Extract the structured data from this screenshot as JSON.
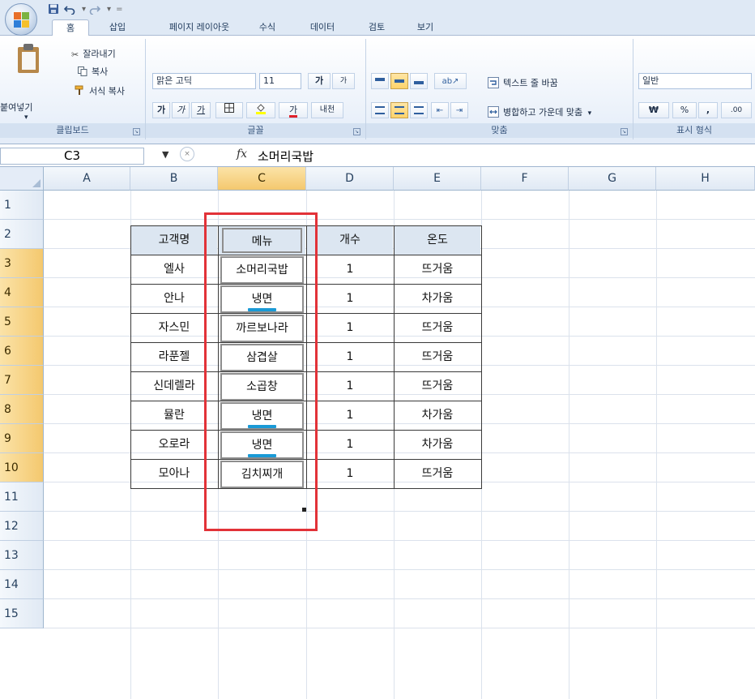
{
  "quick_access": {
    "undo_arrow": "▾",
    "redo_arrow": "▾",
    "customize_arrow": "="
  },
  "tabs": [
    {
      "label": "홈",
      "active": true
    },
    {
      "label": "삽입",
      "active": false
    },
    {
      "label": "페이지 레이아웃",
      "active": false
    },
    {
      "label": "수식",
      "active": false
    },
    {
      "label": "데이터",
      "active": false
    },
    {
      "label": "검토",
      "active": false
    },
    {
      "label": "보기",
      "active": false
    }
  ],
  "ribbon": {
    "clipboard": {
      "paste": "붙여넣기",
      "paste_arrow": "▾",
      "cut": "잘라내기",
      "copy": "복사",
      "format_painter": "서식 복사",
      "label": "클립보드"
    },
    "font": {
      "font_name": "맑은 고딕",
      "font_size": "11",
      "grow": "가",
      "shrink": "가",
      "bold": "가",
      "italic": "가",
      "underline": "가",
      "font_color_letter": "가",
      "phonetic": "내천",
      "label": "글꼴"
    },
    "alignment": {
      "wrap_text": "텍스트 줄 바꿈",
      "merge_center": "병합하고 가운데 맞춤",
      "merge_arrow": "▾",
      "label": "맞춤"
    },
    "number": {
      "format": "일반",
      "currency": "₩",
      "percent": "%",
      "comma": ",",
      "increase_decimal": ".00",
      "label": "표시 형식"
    }
  },
  "formula_bar": {
    "name_box": "C3",
    "fx": "fx",
    "value": "소머리국밥"
  },
  "sheet": {
    "columns": [
      "A",
      "B",
      "C",
      "D",
      "E",
      "F",
      "G",
      "H"
    ],
    "selected_column": "C",
    "rows": [
      "1",
      "2",
      "3",
      "4",
      "5",
      "6",
      "7",
      "8",
      "9",
      "10",
      "11",
      "12",
      "13",
      "14",
      "15"
    ],
    "selected_rows": [
      "3",
      "4",
      "5",
      "6",
      "7",
      "8",
      "9",
      "10"
    ],
    "table": {
      "headers": [
        "고객명",
        "메뉴",
        "개수",
        "온도"
      ],
      "records": [
        {
          "customer": "엘사",
          "menu": "소머리국밥",
          "count": "1",
          "temp": "뜨거움",
          "highlight": false
        },
        {
          "customer": "안나",
          "menu": "냉면",
          "count": "1",
          "temp": "차가움",
          "highlight": true
        },
        {
          "customer": "자스민",
          "menu": "까르보나라",
          "count": "1",
          "temp": "뜨거움",
          "highlight": false
        },
        {
          "customer": "라푼젤",
          "menu": "삼겹살",
          "count": "1",
          "temp": "뜨거움",
          "highlight": false
        },
        {
          "customer": "신데렐라",
          "menu": "소곱창",
          "count": "1",
          "temp": "뜨거움",
          "highlight": false
        },
        {
          "customer": "뮬란",
          "menu": "냉면",
          "count": "1",
          "temp": "차가움",
          "highlight": true
        },
        {
          "customer": "오로라",
          "menu": "냉면",
          "count": "1",
          "temp": "차가움",
          "highlight": true
        },
        {
          "customer": "모아나",
          "menu": "김치찌개",
          "count": "1",
          "temp": "뜨거움",
          "highlight": false
        }
      ]
    }
  },
  "colors": {
    "annotation_frame": "#e23238",
    "underline_highlight": "#1a9ad6",
    "table_header_fill": "#dce6f1",
    "selected_header": "#f4c86e"
  }
}
